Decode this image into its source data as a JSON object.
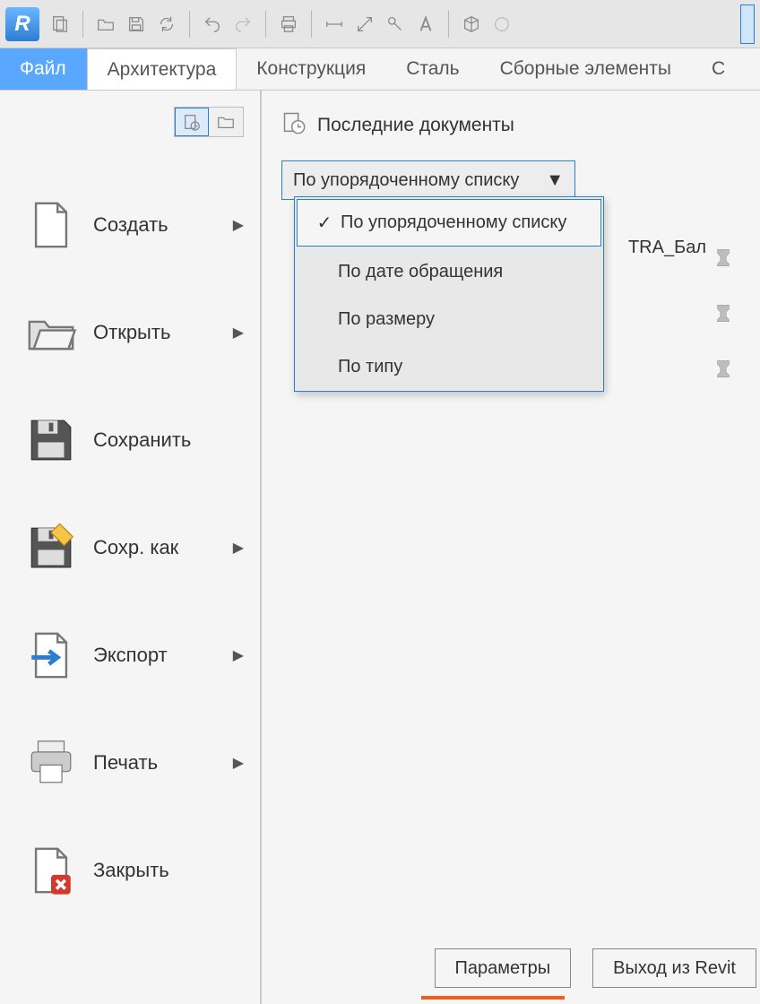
{
  "app": {
    "letter": "R"
  },
  "tabs": {
    "file": "Файл",
    "arch": "Архитектура",
    "constr": "Конструкция",
    "steel": "Сталь",
    "assembly": "Сборные элементы",
    "more": "С"
  },
  "file_menu": {
    "create": "Создать",
    "open": "Открыть",
    "save": "Сохранить",
    "save_as": "Сохр. как",
    "export": "Экспорт",
    "print": "Печать",
    "close": "Закрыть"
  },
  "recent": {
    "title": "Последние документы",
    "sort_selected": "По упорядоченному списку",
    "options": [
      "По упорядоченному списку",
      "По дате обращения",
      "По размеру",
      "По типу"
    ],
    "doc_fragment": "TRA_Бал"
  },
  "buttons": {
    "options": "Параметры",
    "exit": "Выход из Revit"
  }
}
